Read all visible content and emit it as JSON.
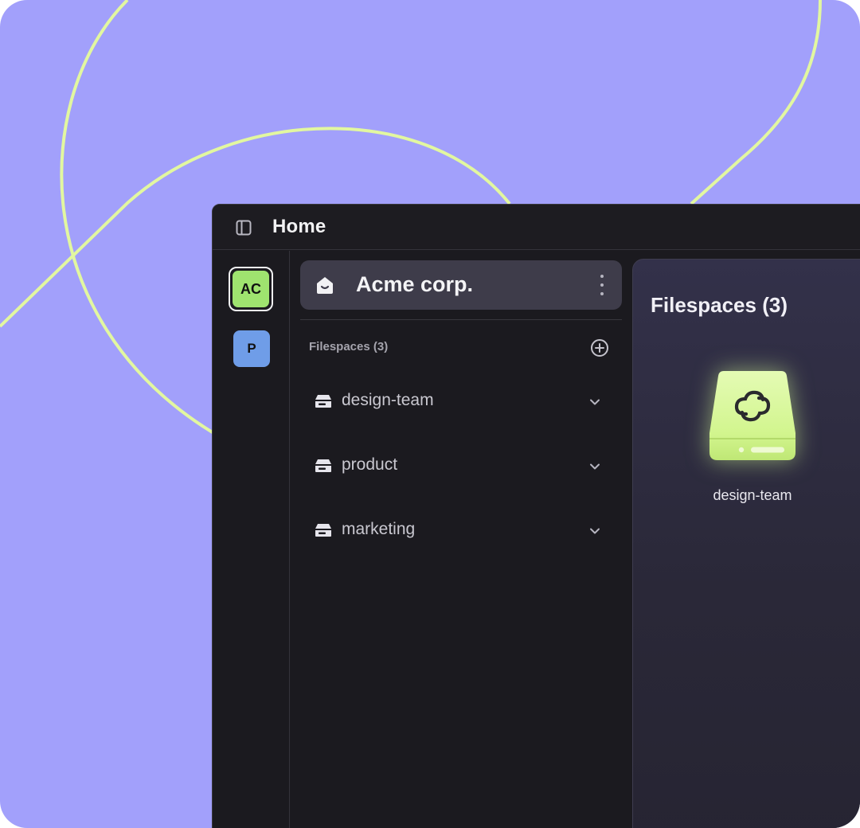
{
  "window": {
    "title": "Home"
  },
  "workspaces": [
    {
      "initials": "AC",
      "color": "#9fe36f",
      "selected": true
    },
    {
      "initials": "P",
      "color": "#6f9de8",
      "selected": false
    }
  ],
  "org": {
    "name": "Acme corp."
  },
  "filespaces_panel": {
    "section_label": "Filespaces (3)",
    "items": [
      {
        "label": "design-team"
      },
      {
        "label": "product"
      },
      {
        "label": "marketing"
      }
    ]
  },
  "main": {
    "title": "Filespaces (3)",
    "tiles": [
      {
        "label": "design-team"
      }
    ]
  },
  "colors": {
    "background": "#a2a0fb",
    "accent_line": "#e2f7a0",
    "window_bg": "#1b1a1f",
    "accent_green": "#9fe36f"
  }
}
